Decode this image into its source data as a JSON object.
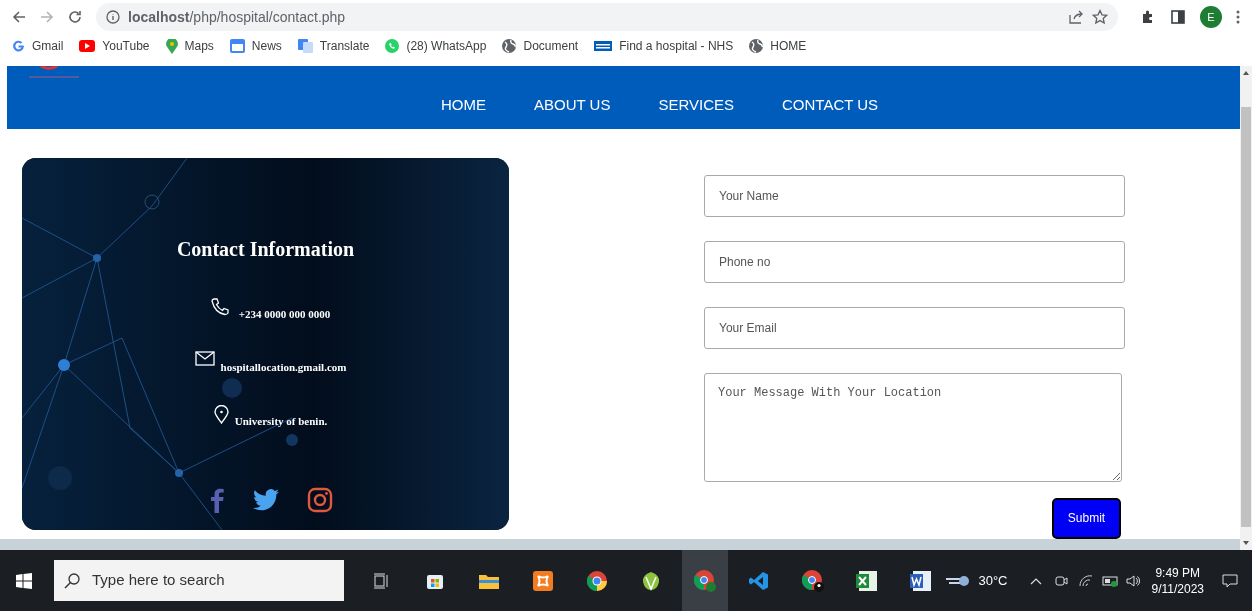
{
  "browser": {
    "url": "**localhost**/php/hospital/contact.php",
    "profile_initial": "E",
    "bookmarks": [
      {
        "kind": "google",
        "label": "Gmail"
      },
      {
        "kind": "youtube",
        "label": "YouTube"
      },
      {
        "kind": "maps",
        "label": "Maps"
      },
      {
        "kind": "news",
        "label": "News"
      },
      {
        "kind": "translate",
        "label": "Translate"
      },
      {
        "kind": "whatsapp",
        "label": "(28) WhatsApp"
      },
      {
        "kind": "globe",
        "label": "Document"
      },
      {
        "kind": "nhs",
        "label": "Find a hospital - NHS"
      },
      {
        "kind": "globe",
        "label": "HOME"
      }
    ]
  },
  "nav": {
    "items": [
      "HOME",
      "ABOUT US",
      "SERVICES",
      "CONTACT US"
    ]
  },
  "contact": {
    "title": "Contact Information",
    "items": [
      {
        "kind": "phone",
        "text": "+234 0000 000 0000"
      },
      {
        "kind": "email",
        "text": "hospitallocation.gmail.com"
      },
      {
        "kind": "location",
        "text": "University of benin."
      }
    ]
  },
  "form": {
    "fields": [
      {
        "kind": "input",
        "placeholder": "Your Name"
      },
      {
        "kind": "input",
        "placeholder": "Phone no"
      },
      {
        "kind": "input",
        "placeholder": "Your Email"
      },
      {
        "kind": "textarea",
        "placeholder": "Your Message With Your Location"
      }
    ],
    "submit": "Submit"
  },
  "taskbar": {
    "search_placeholder": "Type here to search",
    "weather": "30°C",
    "time": "9:49 PM",
    "date": "9/11/2023"
  }
}
